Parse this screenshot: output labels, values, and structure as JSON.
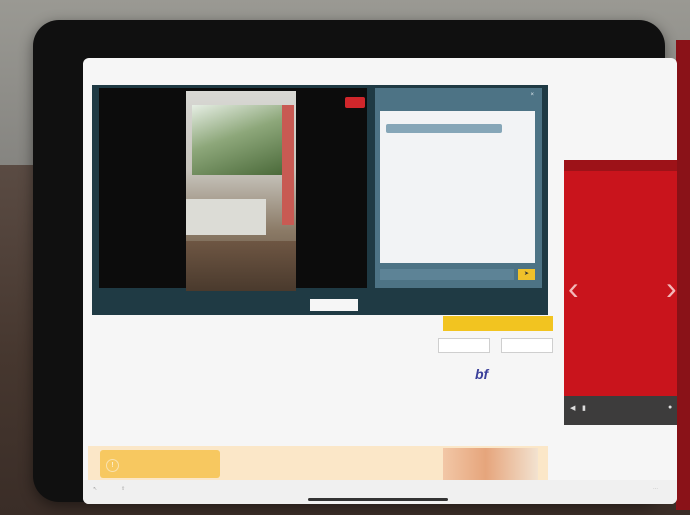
{
  "status_bar": {
    "left_text": "",
    "center_text": "",
    "right_text": ""
  },
  "call": {
    "live_badge": "",
    "chat_title": "",
    "chat_close": "×",
    "message_label": "",
    "message_text": "",
    "input_placeholder": "",
    "send_icon": "➤",
    "tab_1": "",
    "tab_2": "",
    "toggle_text": ""
  },
  "listing": {
    "title": "",
    "detail_1": "",
    "detail_2": "",
    "detail_3": "",
    "price": "",
    "price_sub": "",
    "area": "",
    "area_sub": "",
    "rooms": "",
    "rooms_sub": "",
    "cta_primary": "",
    "cta_secondary_1": "",
    "cta_secondary_2": "",
    "logo": "bf"
  },
  "ad": {
    "header": "",
    "text": "",
    "left_chevron": "‹",
    "right_chevron": "›"
  },
  "banner": {
    "notice_text": "",
    "notice_icon": "!"
  },
  "dock": {
    "item_1": "",
    "item_2": "",
    "item_3": ""
  },
  "icons": {
    "chevron_left_icon": "chevron-left",
    "chevron_right_icon": "chevron-right",
    "send_icon": "send",
    "warning_icon": "warning"
  }
}
